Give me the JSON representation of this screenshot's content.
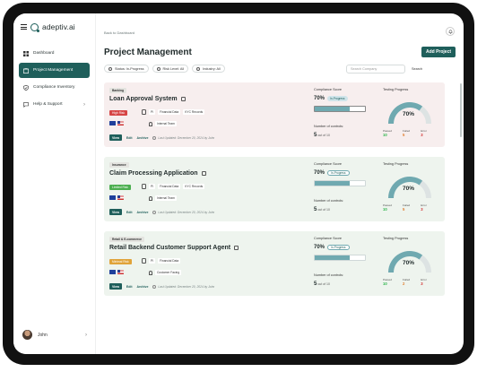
{
  "app": {
    "brand": "adeptiv.ai"
  },
  "sidebar": {
    "items": [
      {
        "label": "Dashboard",
        "icon": "dashboard-icon",
        "active": false
      },
      {
        "label": "Project Management",
        "icon": "project-icon",
        "active": true
      },
      {
        "label": "Compliance Inventory",
        "icon": "shield-check-icon",
        "active": false
      },
      {
        "label": "Help & Support",
        "icon": "chat-icon",
        "active": false
      }
    ],
    "user": {
      "name": "John"
    }
  },
  "header": {
    "breadcrumb": "Back to Dashboard",
    "title": "Project Management",
    "add_button": "Add Project"
  },
  "filters": {
    "status": "Status: In-Progress",
    "risk": "Risk Level: All",
    "industry": "Industry: All",
    "search_placeholder": "Search Company",
    "search_button": "Search"
  },
  "labels": {
    "compliance_score": "Compliance Score",
    "number_of_controls": "Number of controls:",
    "testing_progress": "Testing Progress",
    "passed": "Passed",
    "failed": "Failed",
    "error": "Error",
    "view": "View",
    "edit": "Edit",
    "archive": "Archive",
    "pi": "PI"
  },
  "colors": {
    "accent": "#1f5f5b",
    "passed": "#2bb54a",
    "failed": "#e07b2b",
    "error": "#d32f2f",
    "gauge": "#6fa9b0"
  },
  "projects": [
    {
      "category": "Banking",
      "title": "Loan Approval System",
      "risk": "High Risk",
      "risk_color": "#d64545",
      "tags": [
        "Financial Data",
        "KYC Records"
      ],
      "team": "Internal Team",
      "updated": "Last Updated: December 20, 2024 by John",
      "score": "70%",
      "score_value": 0.7,
      "status": "In-Progress",
      "controls": "5",
      "controls_suffix": "out of 10",
      "progress": "70%",
      "progress_value": 0.7,
      "passed": "10",
      "failed": "5",
      "error": "3"
    },
    {
      "category": "Insurance",
      "title": "Claim Processing Application",
      "risk": "Limited Risk",
      "risk_color": "#4caf50",
      "tags": [
        "Financial Data",
        "KYC Records"
      ],
      "team": "Internal Team",
      "updated": "Last Updated: December 20, 2024 by John",
      "score": "70%",
      "score_value": 0.7,
      "status": "In-Progress",
      "controls": "5",
      "controls_suffix": "out of 10",
      "progress": "70%",
      "progress_value": 0.7,
      "passed": "10",
      "failed": "5",
      "error": "3"
    },
    {
      "category": "Retail & E-commerce",
      "title": "Retail Backend Customer Support Agent",
      "risk": "Minimal Risk",
      "risk_color": "#e0a33a",
      "tags": [
        "Financial Data"
      ],
      "team": "Customer Facing",
      "updated": "Last Updated: December 20, 2024 by John",
      "score": "70%",
      "score_value": 0.7,
      "status": "In-Progress",
      "controls": "5",
      "controls_suffix": "out of 10",
      "progress": "70%",
      "progress_value": 0.7,
      "passed": "10",
      "failed": "2",
      "error": "3"
    }
  ]
}
